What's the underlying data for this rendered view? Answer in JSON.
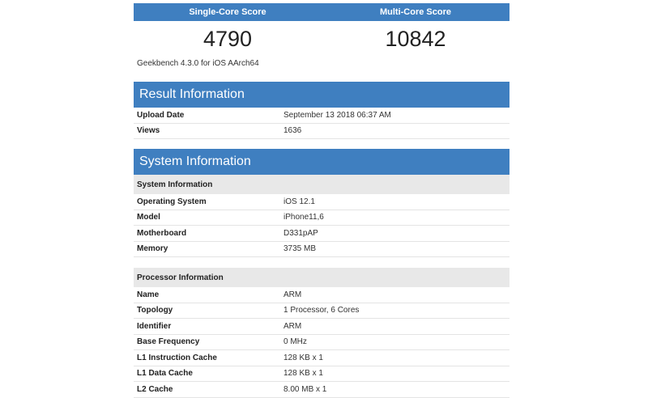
{
  "scores": {
    "single_label": "Single-Core Score",
    "multi_label": "Multi-Core Score",
    "single_value": "4790",
    "multi_value": "10842",
    "version": "Geekbench 4.3.0 for iOS AArch64"
  },
  "result": {
    "title": "Result Information",
    "rows": [
      {
        "key": "Upload Date",
        "value": "September 13 2018 06:37 AM"
      },
      {
        "key": "Views",
        "value": "1636"
      }
    ]
  },
  "system": {
    "title": "System Information",
    "sys_subtitle": "System Information",
    "sys_rows": [
      {
        "key": "Operating System",
        "value": "iOS 12.1"
      },
      {
        "key": "Model",
        "value": "iPhone11,6"
      },
      {
        "key": "Motherboard",
        "value": "D331pAP"
      },
      {
        "key": "Memory",
        "value": "3735 MB"
      }
    ],
    "proc_subtitle": "Processor Information",
    "proc_rows": [
      {
        "key": "Name",
        "value": "ARM"
      },
      {
        "key": "Topology",
        "value": "1 Processor, 6 Cores"
      },
      {
        "key": "Identifier",
        "value": "ARM"
      },
      {
        "key": "Base Frequency",
        "value": "0 MHz"
      },
      {
        "key": "L1 Instruction Cache",
        "value": "128 KB x 1"
      },
      {
        "key": "L1 Data Cache",
        "value": "128 KB x 1"
      },
      {
        "key": "L2 Cache",
        "value": "8.00 MB x 1"
      }
    ]
  }
}
